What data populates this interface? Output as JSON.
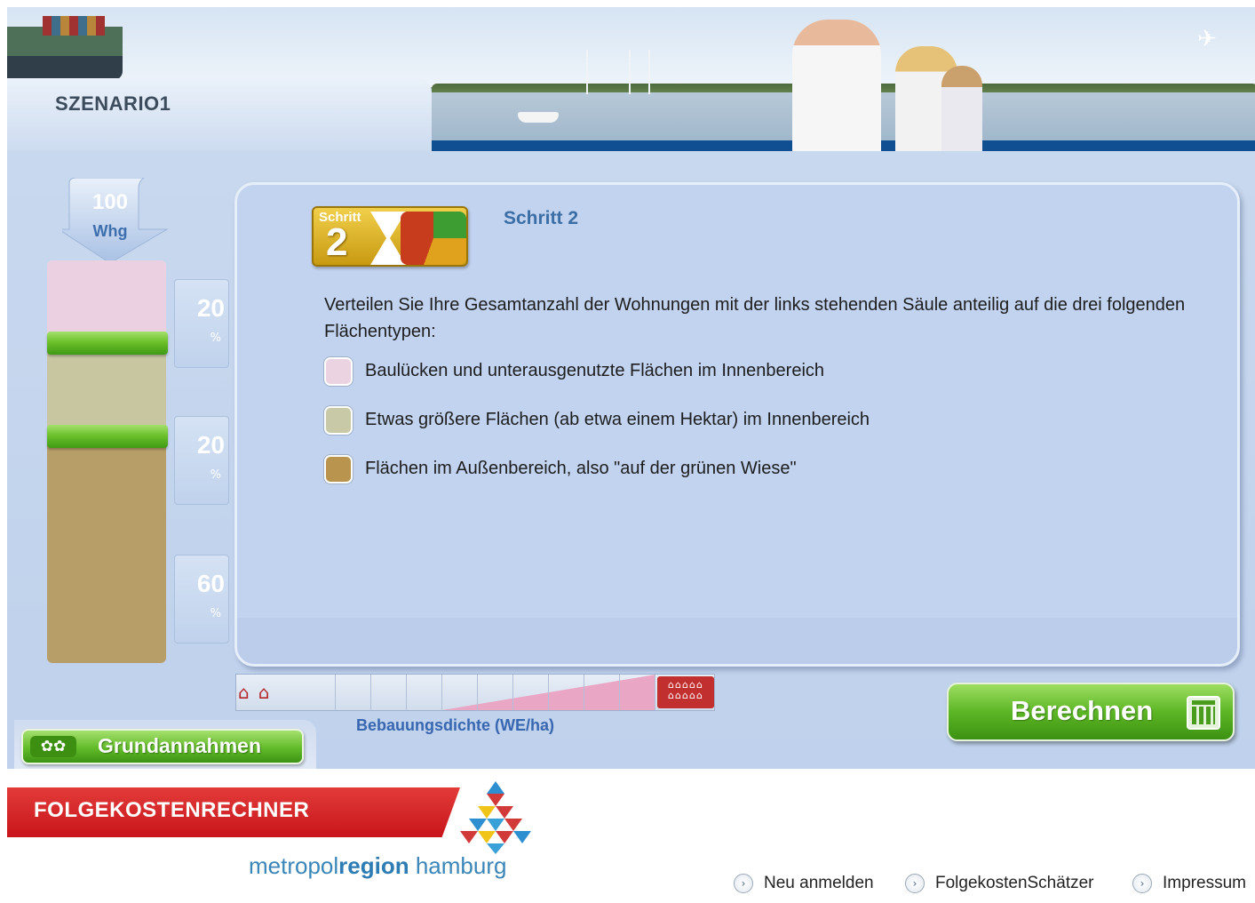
{
  "header": {
    "scenario_title": "SZENARIO1"
  },
  "sidebar": {
    "total": {
      "value": "100",
      "unit": "Whg"
    },
    "segments": [
      {
        "name": "pink",
        "color": "#ebd0e1",
        "percent": "20",
        "unit": "%"
      },
      {
        "name": "green",
        "color": "#c7c6a1",
        "percent": "20",
        "unit": "%"
      },
      {
        "name": "brown",
        "color": "#b79e68",
        "percent": "60",
        "unit": "%"
      }
    ]
  },
  "step": {
    "badge_word": "Schritt",
    "badge_number": "2",
    "title": "Schritt 2",
    "instruction": "Verteilen Sie Ihre Gesamtanzahl der Wohnungen mit der links stehenden Säule anteilig auf die drei folgenden Flächentypen:",
    "legend": [
      {
        "color": "#ecd3e2",
        "label": "Baulücken und unterausgenutzte Flächen im Innenbereich"
      },
      {
        "color": "#c8c9a6",
        "label": "Etwas größere Flächen (ab etwa einem Hektar) im Innenbereich"
      },
      {
        "color": "#b8944f",
        "label": "Flächen im Außenbereich, also \"auf der grünen Wiese\""
      }
    ]
  },
  "density": {
    "label": "Bebauungsdichte (WE/ha)"
  },
  "buttons": {
    "calculate": "Berechnen",
    "assumptions": "Grundannahmen"
  },
  "footer": {
    "brand_title": "FOLGEKOSTENRECHNER",
    "region_prefix": "metropol",
    "region_bold": "region",
    "region_suffix": " hamburg",
    "links": [
      {
        "label": "Neu anmelden"
      },
      {
        "label": "FolgekostenSchätzer"
      },
      {
        "label": "Impressum"
      }
    ]
  },
  "colors": {
    "accent_green": "#5db625",
    "brand_red": "#c8151b",
    "link_blue": "#3767b0"
  }
}
